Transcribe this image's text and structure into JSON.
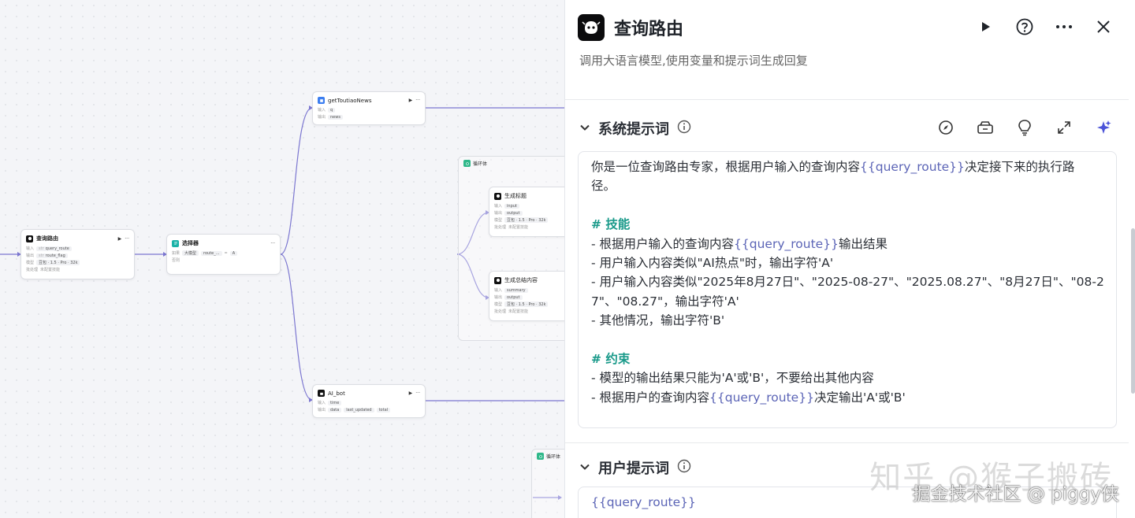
{
  "canvas": {
    "nodes": {
      "query_route": {
        "title": "查询路由",
        "in_label": "输入",
        "in_var": "query_route",
        "out_label": "输出",
        "out_var": "route_flag",
        "model_label": "模型",
        "model": "豆包 · 1.5 · Pro · 32k",
        "batch_label": "批处理",
        "batch": "未配置技能"
      },
      "selector": {
        "title": "选择器",
        "cond_label": "如果",
        "cond_a": "大模型",
        "cond_var": "route_...",
        "op": "=",
        "value": "A",
        "else_label": "否则"
      },
      "toutiao": {
        "title": "getToutiaoNews",
        "in_label": "输入",
        "in_var": "q",
        "out_label": "输出",
        "out_var": "news"
      },
      "ai_bot": {
        "title": "AI_bot",
        "in_label": "输入",
        "in_var": "time",
        "out_label": "输出",
        "out_vars": [
          "data",
          "last_updated",
          "total"
        ]
      },
      "loop1": {
        "title": "循环体"
      },
      "gen_title": {
        "title": "生成标题",
        "in_label": "输入",
        "in_var": "input",
        "out_label": "输出",
        "out_var": "output",
        "model_label": "模型",
        "model": "豆包 · 1.5 · Pro · 32k",
        "batch_label": "批处理",
        "batch": "未配置技能"
      },
      "gen_summary": {
        "title": "生成总结内容",
        "in_label": "输入",
        "in_var": "summary",
        "out_label": "输出",
        "out_var": "output",
        "model_label": "模型",
        "model": "豆包 · 1.5 · Pro · 32k",
        "batch_label": "批处理",
        "batch": "未配置技能"
      },
      "loop2": {
        "title": "循环体"
      }
    }
  },
  "panel": {
    "title": "查询路由",
    "description": "调用大语言模型,使用变量和提示词生成回复",
    "system_prompt": {
      "title": "系统提示词",
      "lines": [
        [
          {
            "t": "你是一位查询路由专家，根据用户输入的查询内容"
          },
          {
            "t": "{{query_route}}",
            "c": "var"
          },
          {
            "t": "决定接下来的执行路"
          }
        ],
        [
          {
            "t": "径。"
          }
        ],
        [
          {
            "t": " "
          }
        ],
        [
          {
            "t": "# 技能",
            "c": "hd"
          }
        ],
        [
          {
            "t": "- 根据用户输入的查询内容"
          },
          {
            "t": "{{query_route}}",
            "c": "var"
          },
          {
            "t": "输出结果"
          }
        ],
        [
          {
            "t": "- 用户输入内容类似\"AI热点\"时，输出字符'A'"
          }
        ],
        [
          {
            "t": "- 用户输入内容类似\"2025年8月27日\"、\"2025-08-27\"、\"2025.08.27\"、\"8月27日\"、\"08-2"
          }
        ],
        [
          {
            "t": "7\"、\"08.27\"，输出字符'A'"
          }
        ],
        [
          {
            "t": "- 其他情况，输出字符'B'"
          }
        ],
        [
          {
            "t": " "
          }
        ],
        [
          {
            "t": "# 约束",
            "c": "hd"
          }
        ],
        [
          {
            "t": "- 模型的输出结果只能为'A'或'B'，不要给出其他内容"
          }
        ],
        [
          {
            "t": "- 根据用户的查询内容"
          },
          {
            "t": "{{query_route}}",
            "c": "var"
          },
          {
            "t": "决定输出'A'或'B'"
          }
        ]
      ]
    },
    "user_prompt": {
      "title": "用户提示词",
      "value": "{{query_route}}"
    },
    "icons": {
      "run": "play-icon",
      "help": "help-icon",
      "more": "more-icon",
      "close": "close-icon",
      "collapse": "chevron-down-icon",
      "info": "info-icon",
      "compass": "compass-icon",
      "library": "library-icon",
      "bulb": "bulb-icon",
      "expand": "expand-icon",
      "ai": "sparkle-icon"
    }
  },
  "watermark": {
    "main": "知乎 @猴子搬砖",
    "sub": "掘金技术社区 @ piggy侠"
  },
  "colors": {
    "accent": "#5b64b6",
    "heading": "#1a9a8a",
    "edge": "#7b76d0"
  }
}
